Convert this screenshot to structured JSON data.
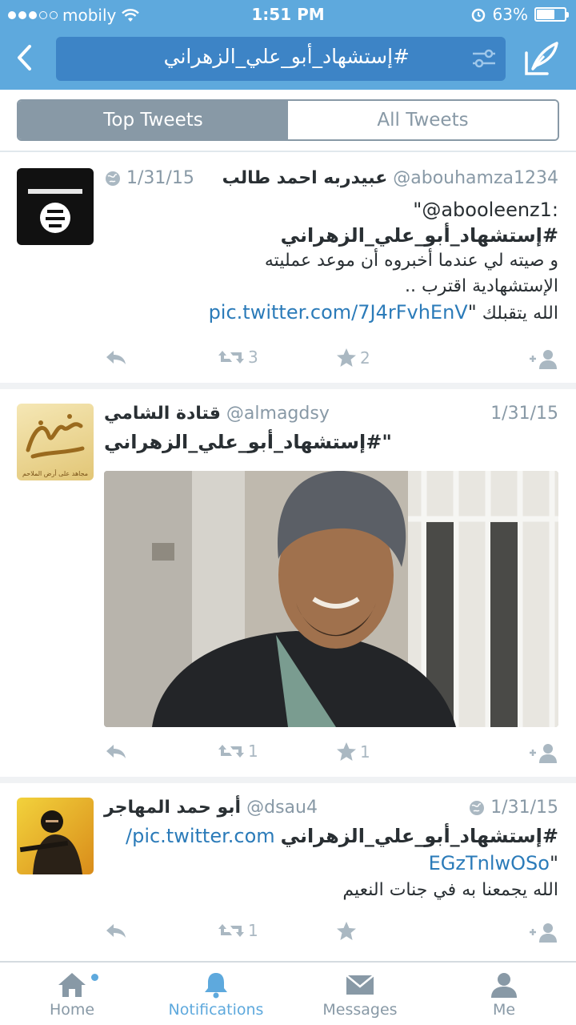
{
  "status_bar": {
    "carrier": "mobily",
    "time": "1:51 PM",
    "battery_percent": "63%",
    "signal_bars_filled": 3,
    "signal_bars_total": 5
  },
  "search": {
    "query": "#إستشهاد_أبو_علي_الزهراني"
  },
  "segments": {
    "top": "Top Tweets",
    "all": "All Tweets",
    "selected": "Top Tweets"
  },
  "colors": {
    "brand": "#5ea9dd",
    "search_bg": "#3d84c6",
    "link": "#2b7bb9",
    "muted": "#8899a6"
  },
  "tweets": [
    {
      "name": "عبيدربه احمد طالب",
      "handle": "@abouhamza1234",
      "date": "1/31/15",
      "has_globe": true,
      "line1": "\"@abooleenz1:",
      "line2": "#إستشهاد_أبو_علي_الزهراني",
      "line3": "و صيته لي عندما أخبروه أن موعد عمليته",
      "line4": "الإستشهادية اقترب ..",
      "line5_text": "الله يتقبلك ",
      "line5_link": "pic.twitter.com/7J4rFvhEnV",
      "line5_end": "\"",
      "retweets": "3",
      "favorites": "2",
      "avatar_icon": "black-flag-avatar"
    },
    {
      "name": "قتادة الشامي",
      "handle": "@almagdsy",
      "date": "1/31/15",
      "has_globe": false,
      "line1": "\"#إستشهاد_أبو_علي_الزهراني",
      "retweets": "1",
      "favorites": "1",
      "avatar_icon": "calligraphy-avatar",
      "avatar_caption": "مجاهد على أرض الملاحم",
      "photo": "young-man-in-beanie-photo"
    },
    {
      "name": "أبو حمد المهاجر",
      "handle": "@dsau4",
      "date": "1/31/15",
      "has_globe": true,
      "line1_hashtag": "#إستشهاد_أبو_علي_الزهراني",
      "line1_link": "pic.twitter.com/",
      "line2_link": "EGzTnlwOSo",
      "line2_end": "\"",
      "line3": "الله يجمعنا به في جنات النعيم",
      "retweets": "1",
      "favorites": "",
      "avatar_icon": "masked-gunman-avatar"
    }
  ],
  "tabs": [
    {
      "label": "Home",
      "icon": "home-icon"
    },
    {
      "label": "Notifications",
      "icon": "bell-icon"
    },
    {
      "label": "Messages",
      "icon": "envelope-icon"
    },
    {
      "label": "Me",
      "icon": "person-icon"
    }
  ]
}
